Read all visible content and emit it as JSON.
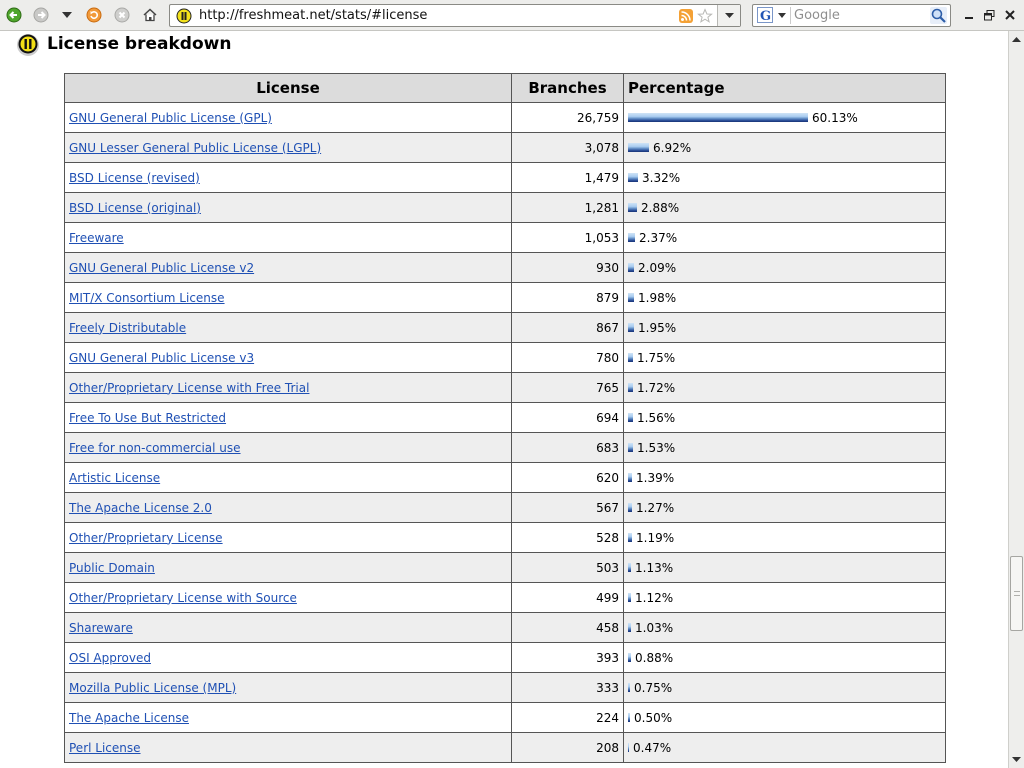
{
  "browser": {
    "url": "http://freshmeat.net/stats/#license",
    "search_placeholder": "Google"
  },
  "page": {
    "title": "License breakdown"
  },
  "table": {
    "headers": [
      "License",
      "Branches",
      "Percentage"
    ],
    "rows": [
      {
        "license": "GNU General Public License (GPL)",
        "branches": "26,759",
        "percent_label": "60.13%",
        "percent": 60.13
      },
      {
        "license": "GNU Lesser General Public License (LGPL)",
        "branches": "3,078",
        "percent_label": "6.92%",
        "percent": 6.92
      },
      {
        "license": "BSD License (revised)",
        "branches": "1,479",
        "percent_label": "3.32%",
        "percent": 3.32
      },
      {
        "license": "BSD License (original)",
        "branches": "1,281",
        "percent_label": "2.88%",
        "percent": 2.88
      },
      {
        "license": "Freeware",
        "branches": "1,053",
        "percent_label": "2.37%",
        "percent": 2.37
      },
      {
        "license": "GNU General Public License v2",
        "branches": "930",
        "percent_label": "2.09%",
        "percent": 2.09
      },
      {
        "license": "MIT/X Consortium License",
        "branches": "879",
        "percent_label": "1.98%",
        "percent": 1.98
      },
      {
        "license": "Freely Distributable",
        "branches": "867",
        "percent_label": "1.95%",
        "percent": 1.95
      },
      {
        "license": "GNU General Public License v3",
        "branches": "780",
        "percent_label": "1.75%",
        "percent": 1.75
      },
      {
        "license": "Other/Proprietary License with Free Trial",
        "branches": "765",
        "percent_label": "1.72%",
        "percent": 1.72
      },
      {
        "license": "Free To Use But Restricted",
        "branches": "694",
        "percent_label": "1.56%",
        "percent": 1.56
      },
      {
        "license": "Free for non-commercial use",
        "branches": "683",
        "percent_label": "1.53%",
        "percent": 1.53
      },
      {
        "license": "Artistic License",
        "branches": "620",
        "percent_label": "1.39%",
        "percent": 1.39
      },
      {
        "license": "The Apache License 2.0",
        "branches": "567",
        "percent_label": "1.27%",
        "percent": 1.27
      },
      {
        "license": "Other/Proprietary License",
        "branches": "528",
        "percent_label": "1.19%",
        "percent": 1.19
      },
      {
        "license": "Public Domain",
        "branches": "503",
        "percent_label": "1.13%",
        "percent": 1.13
      },
      {
        "license": "Other/Proprietary License with Source",
        "branches": "499",
        "percent_label": "1.12%",
        "percent": 1.12
      },
      {
        "license": "Shareware",
        "branches": "458",
        "percent_label": "1.03%",
        "percent": 1.03
      },
      {
        "license": "OSI Approved",
        "branches": "393",
        "percent_label": "0.88%",
        "percent": 0.88
      },
      {
        "license": "Mozilla Public License (MPL)",
        "branches": "333",
        "percent_label": "0.75%",
        "percent": 0.75
      },
      {
        "license": "The Apache License",
        "branches": "224",
        "percent_label": "0.50%",
        "percent": 0.5
      },
      {
        "license": "Perl License",
        "branches": "208",
        "percent_label": "0.47%",
        "percent": 0.47
      }
    ]
  },
  "colors": {
    "link": "#1f50b4",
    "header_bg": "#dcdcdc",
    "alt_row_bg": "#eeeeee",
    "bar_dark": "#1f3f8c",
    "bar_light": "#a9ccf0"
  },
  "icons": {
    "back": "back-arrow-icon",
    "forward": "forward-arrow-icon",
    "history": "history-dropdown-icon",
    "reload": "reload-icon",
    "stop": "stop-icon",
    "home": "home-icon",
    "site": "site-favicon-icon",
    "rss": "rss-feed-icon",
    "bookmark": "bookmark-star-icon",
    "search_engine": "google-icon",
    "search_go": "search-magnifier-icon"
  }
}
